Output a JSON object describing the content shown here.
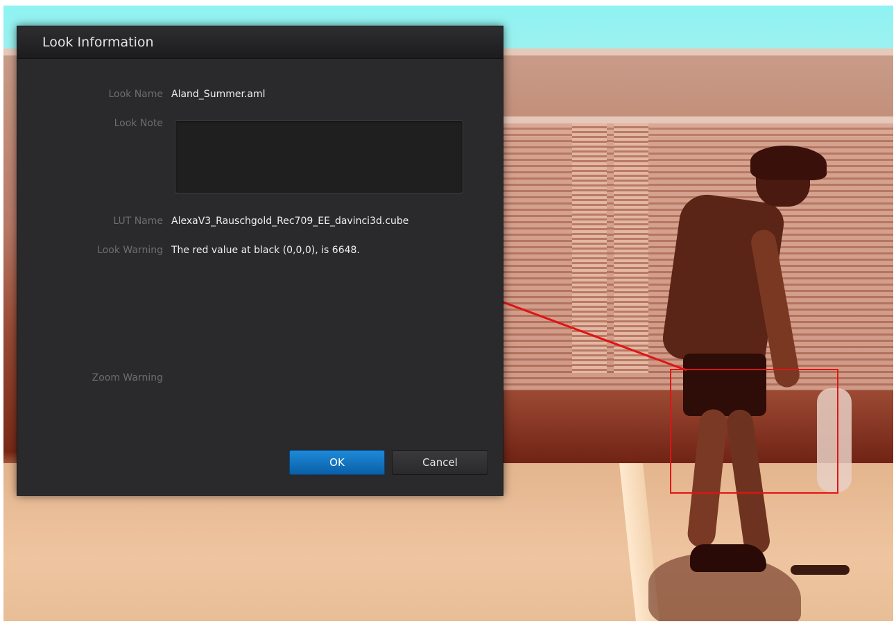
{
  "dialog": {
    "title": "Look Information",
    "look_name": {
      "label": "Look Name",
      "value": "Aland_Summer.aml"
    },
    "look_note": {
      "label": "Look Note",
      "value": ""
    },
    "lut_name": {
      "label": "LUT Name",
      "value": "AlexaV3_Rauschgold_Rec709_EE_davinci3d.cube"
    },
    "look_warning": {
      "label": "Look Warning",
      "value": "The red value at black (0,0,0), is 6648."
    },
    "zoom_warning": {
      "label": "Zoom Warning",
      "value": ""
    },
    "buttons": {
      "ok": "OK",
      "cancel": "Cancel"
    }
  },
  "colors": {
    "dialog_bg": "#2a2a2c",
    "ok_button": "#1478c8",
    "annotation": "#e01414"
  }
}
